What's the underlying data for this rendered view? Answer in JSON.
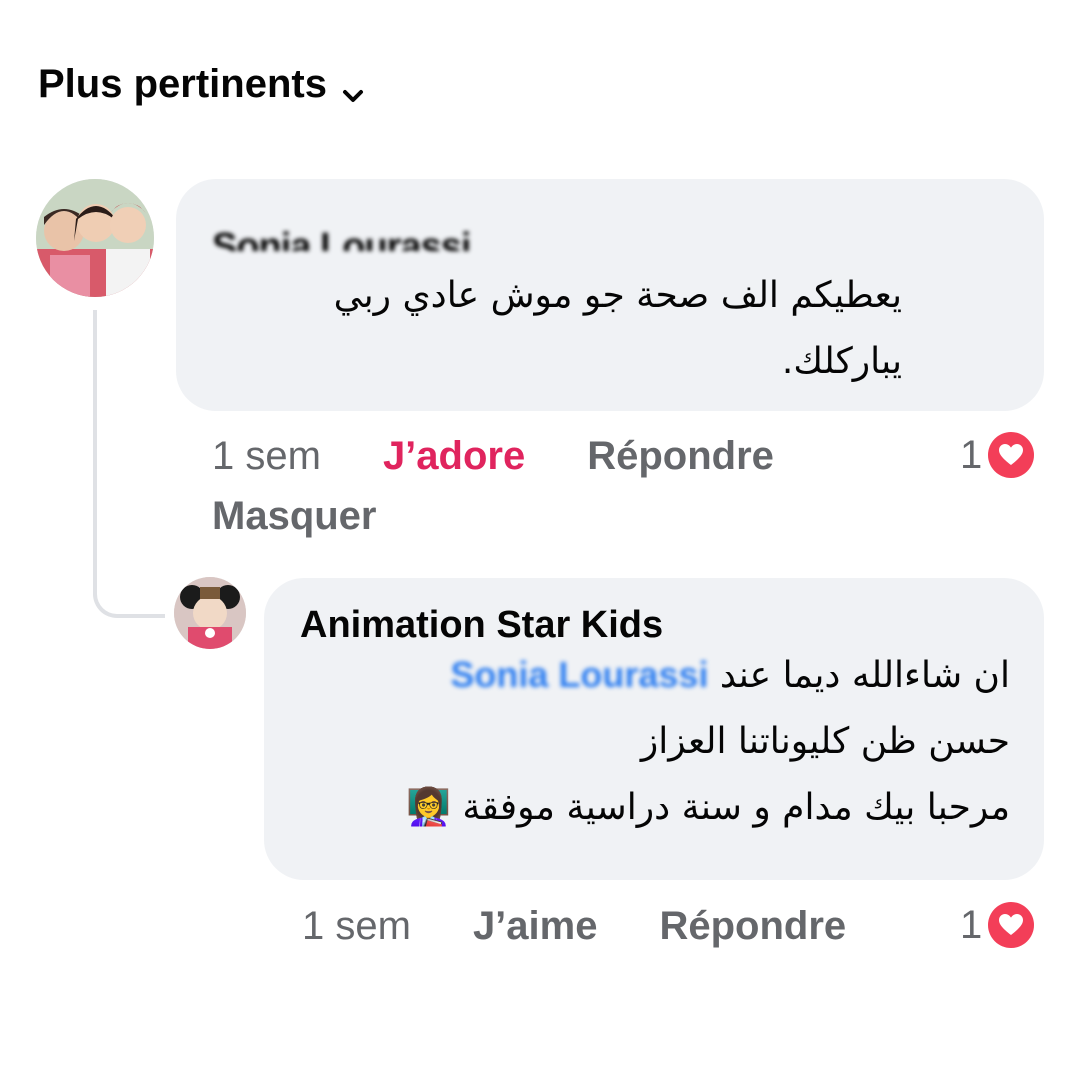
{
  "sort": {
    "label": "Plus pertinents",
    "icon": "chevron-down-icon"
  },
  "comments": [
    {
      "author": "Sonia Lourassi",
      "text": "يعطيكم الف صحة جو موش عادي ربي يباركلك.",
      "time": "1 sem",
      "reaction_label": "J’adore",
      "reply_label": "Répondre",
      "hide_label": "Masquer",
      "reaction_count": "1",
      "reaction_icon": "heart-icon"
    },
    {
      "author": "Animation Star Kids",
      "mention": "Sonia Lourassi",
      "text_line1": "ان شاءالله ديما عند",
      "text_line2": "حسن ظن كليوناتنا العزاز",
      "text_line3": "مرحبا بيك مدام و سنة دراسية موفقة",
      "emoji": "👩‍🏫",
      "time": "1 sem",
      "like_label": "J’aime",
      "reply_label": "Répondre",
      "reaction_count": "1",
      "reaction_icon": "heart-icon"
    }
  ],
  "colors": {
    "reaction_active": "#e0245e",
    "heart": "#f33e58",
    "mention": "#2f7ff0",
    "bubble": "#f0f2f5"
  }
}
